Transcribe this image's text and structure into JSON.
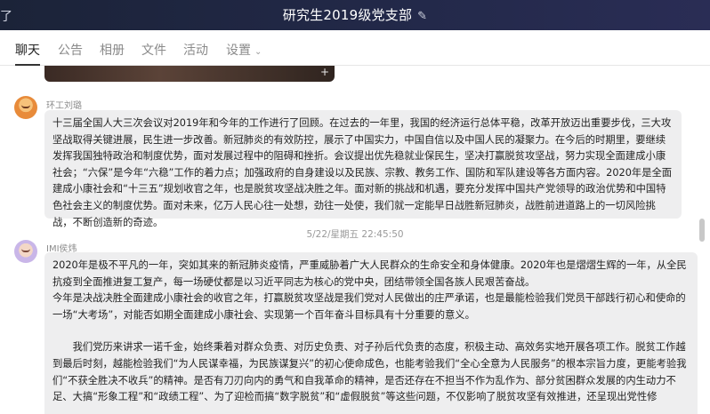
{
  "window": {
    "title": "研究生2019级党支部",
    "left_glyph": "了"
  },
  "tabs": [
    {
      "label": "聊天",
      "active": true
    },
    {
      "label": "公告",
      "active": false
    },
    {
      "label": "相册",
      "active": false
    },
    {
      "label": "文件",
      "active": false
    },
    {
      "label": "活动",
      "active": false
    },
    {
      "label": "设置",
      "active": false
    }
  ],
  "chat": {
    "video_plus": "+",
    "messages": [
      {
        "sender": "环工刘璐",
        "paragraphs": [
          "十三届全国人大三次会议对2019年和今年的工作进行了回顾。在过去的一年里，我国的经济运行总体平稳，改革开放迈出重要步伐，三大攻坚战取得关键进展，民生进一步改善。新冠肺炎的有效防控，展示了中国实力，中国自信以及中国人民的凝聚力。在今后的时期里，要继续发挥我国独特政治和制度优势，面对发展过程中的阻碍和挫折。会议提出优先稳就业保民生，坚决打赢脱贫攻坚战，努力实现全面建成小康社会；“六保”是今年“六稳”工作的着力点；加强政府的自身建设以及民族、宗教、教务工作、国防和军队建设等各方面内容。2020年是全面建成小康社会和“十三五”规划收官之年，也是脱贫攻坚战决胜之年。面对新的挑战和机遇，要充分发挥中国共产党领导的政治优势和中国特色社会主义的制度优势。面对未来，亿万人民心往一处想，劲往一处使，我们就一定能早日战胜新冠肺炎，战胜前进道路上的一切风险挑战，不断创造新的奇迹。"
        ]
      },
      {
        "timestamp": "5/22/星期五 22:45:50",
        "sender": "IMI侯炜",
        "paragraphs": [
          "2020年是极不平凡的一年，突如其来的新冠肺炎疫情，严重威胁着广大人民群众的生命安全和身体健康。2020年也是熠熠生辉的一年，从全民抗疫到全面推进复工复产，每一场硬仗都是以习近平同志为核心的党中央，团结带领全国各族人民艰苦奋战。",
          "今年是决战决胜全面建成小康社会的收官之年，打赢脱贫攻坚战是我们党对人民做出的庄严承诺，也是最能检验我们党员干部践行初心和使命的一场“大考场”，对能否如期全面建成小康社会、实现第一个百年奋斗目标具有十分重要的意义。",
          "我们党历来讲求一诺千金，始终秉着对群众负责、对历史负责、对子孙后代负责的态度，积极主动、高效务实地开展各项工作。脱贫工作越到最后时刻，越能检验我们“为人民谋幸福，为民族谋复兴”的初心使命成色，也能考验我们“全心全意为人民服务”的根本宗旨力度，更能考验我们“不获全胜决不收兵”的精神。是否有刀刃向内的勇气和自我革命的精神，是否还存在不担当不作为乱作为、部分贫困群众发展的内生动力不足、大搞“形象工程”和“政绩工程”、为了迎检而搞“数字脱贫”和“虚假脱贫”等这些问题，不仅影响了脱贫攻坚有效推进，还呈现出党性修"
        ]
      }
    ]
  },
  "colors": {
    "titlebar": "#1b2338",
    "bubble": "#eeeeef",
    "active_tab": "#222222",
    "inactive_tab": "#8a8a8a"
  },
  "icons": {
    "edit": "pencil-edit-icon",
    "settings_dropdown": "chevron-down-icon",
    "video_expand": "plus-icon"
  }
}
